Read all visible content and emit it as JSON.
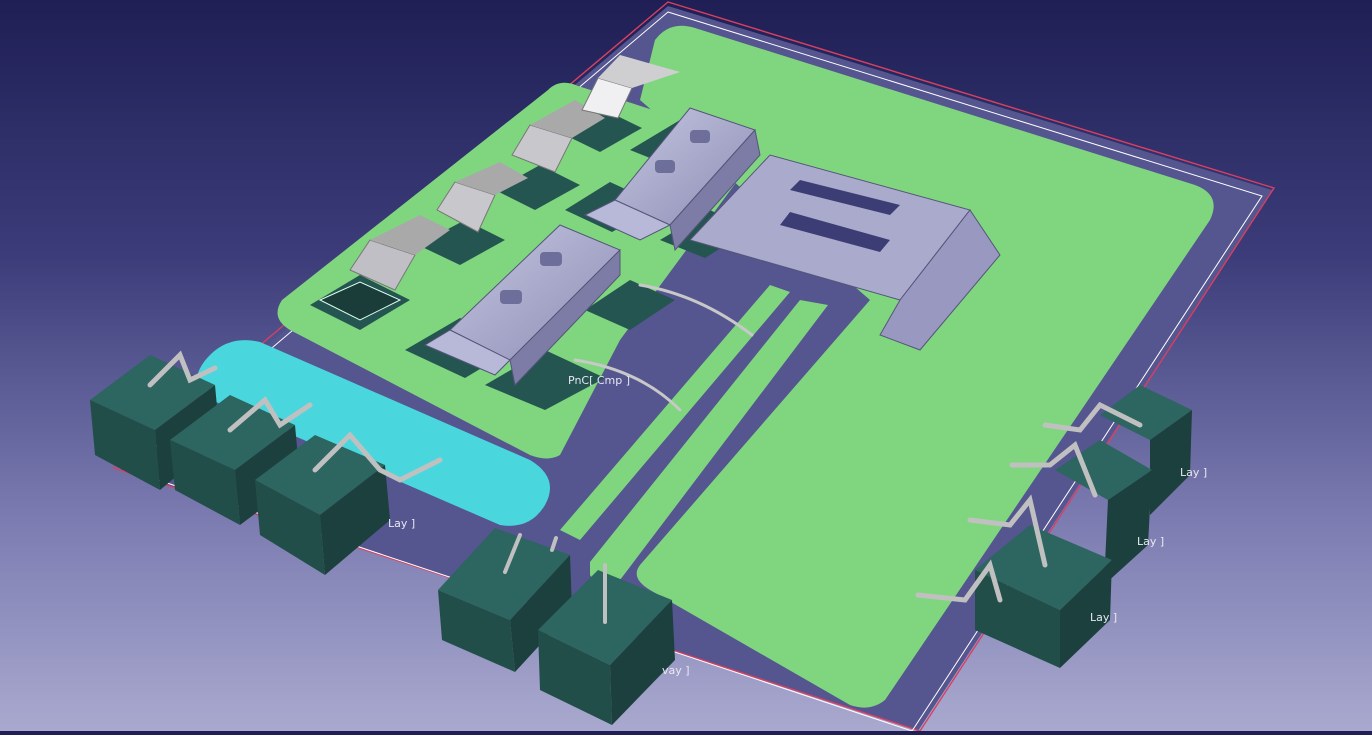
{
  "viewer": {
    "background_top": "#1f1f55",
    "background_bottom": "#a9a9cf",
    "board_color": "#80d67f",
    "substrate_color": "#545489",
    "cyan_region_color": "#49d7dd",
    "terminal_color": "#255551",
    "clip_color": "#aaaacc",
    "wire_color": "#bfbfbf",
    "outline_color": "#d94060"
  },
  "labels": {
    "component_tag": "PnC[ Cmp ]",
    "left_terminal_tag": "Lay ]",
    "right_terminal_tag_1": "Lay ]",
    "right_terminal_tag_2": "Lay ]",
    "right_terminal_tag_3": "Lay ]",
    "bottom_terminal_tag": "vay ]"
  }
}
